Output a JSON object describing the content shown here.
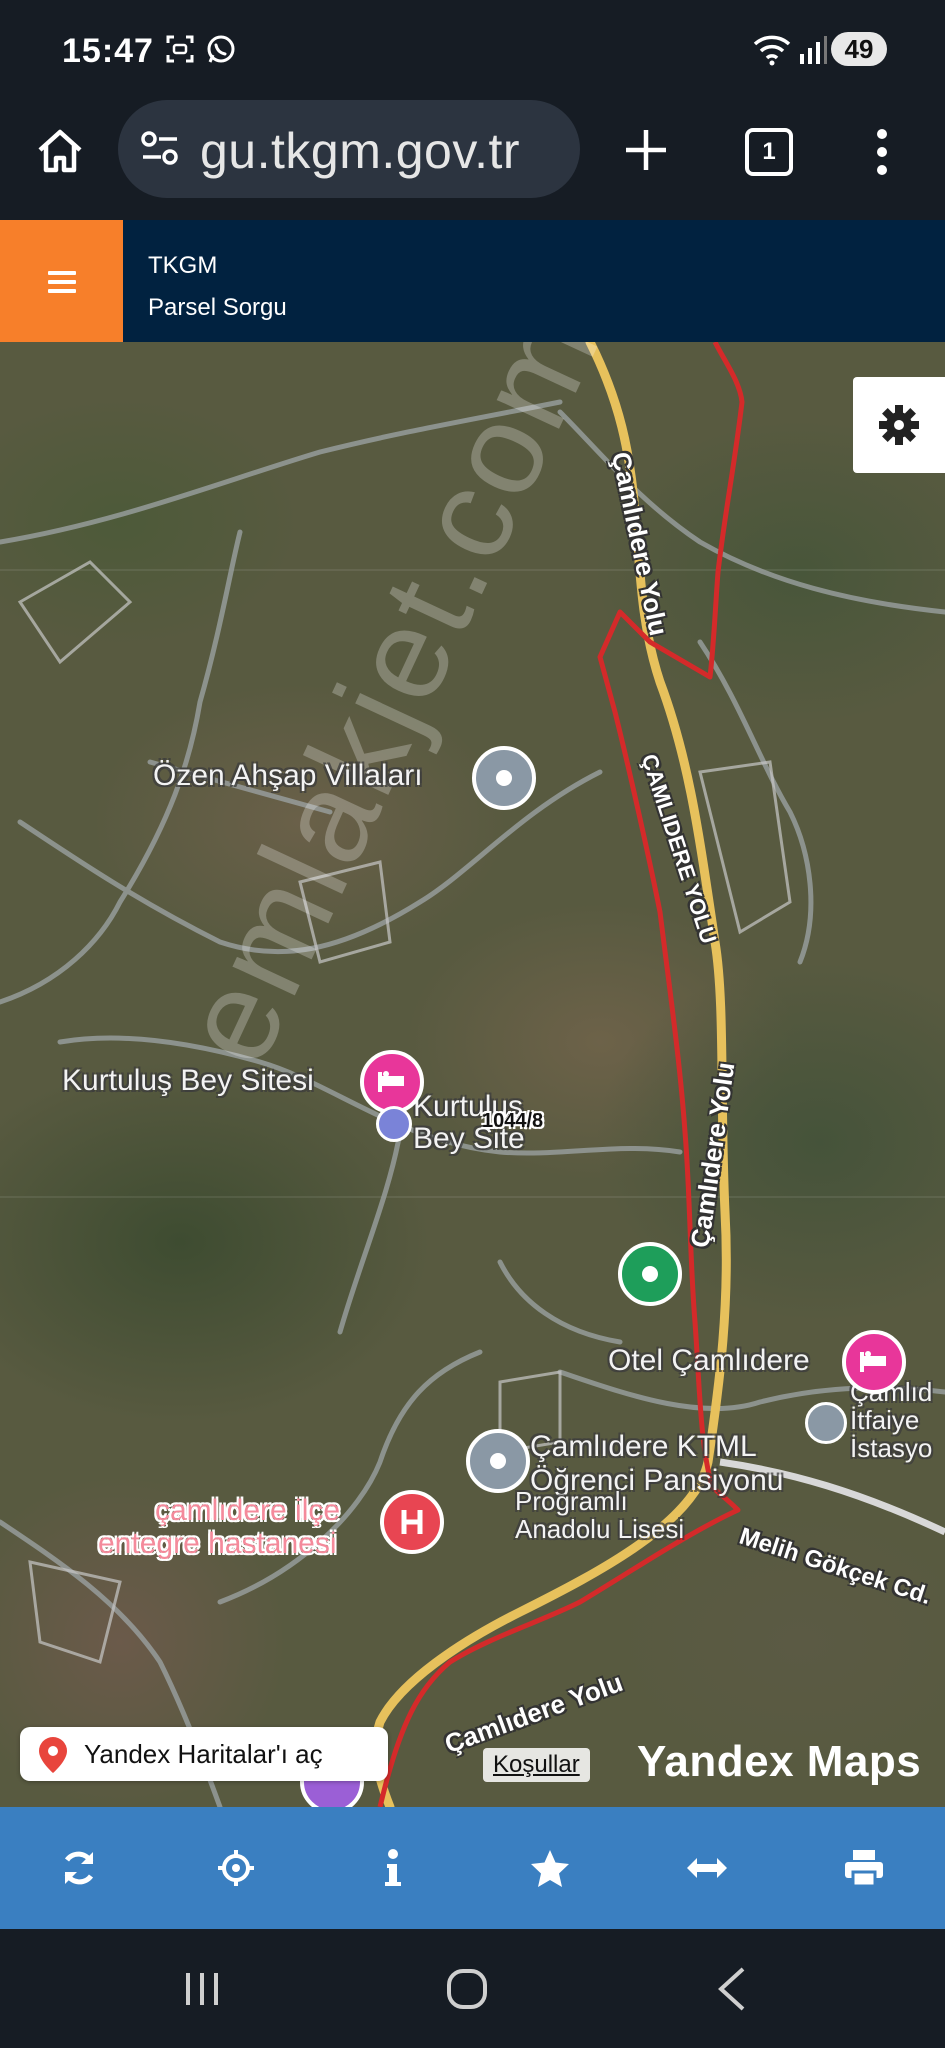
{
  "status": {
    "time": "15:47",
    "battery": "49"
  },
  "browser": {
    "url": "gu.tkgm.gov.tr",
    "tab_count": "1"
  },
  "app": {
    "title": "TKGM",
    "subtitle": "Parsel Sorgu"
  },
  "map": {
    "places": {
      "ozen": "Özen Ahşap Villaları",
      "kurtulus": "Kurtuluş Bey Sitesi",
      "kurtulus2a": "Kurtuluş",
      "kurtulus2b": "Bey Site",
      "otel": "Otel Çamlıdere",
      "itfaiye_a": "Çamlıd",
      "itfaiye_b": "İtfaiye",
      "itfaiye_c": "İstasyo",
      "ktml": "Çamlıdere KTML",
      "pansiyon": "Öğrenci Pansiyonu",
      "programli": "Programlı",
      "anadolu": "Anadolu Lisesi",
      "hastane_a": "çamlıdere ilçe",
      "hastane_b": "entegre hastanesi"
    },
    "roads": {
      "camlidere_yolu": "Çamlıdere Yolu",
      "camlidere_yolu_caps": "ÇAMLIDERE YOLU",
      "melih": "Melih Gökçek Cd."
    },
    "parcel_label": "1044/8",
    "watermark": "emlakjet.com",
    "yandex_link": "Yandex Haritalar'ı aç",
    "terms": "Koşullar",
    "brand": "Yandex Maps"
  },
  "colors": {
    "header": "#012240",
    "menu": "#f77f2a",
    "toolbar": "#3a7fc1",
    "parcel": "#d42a2a"
  },
  "toolbar_icons": [
    "refresh-icon",
    "locate-icon",
    "info-icon",
    "star-icon",
    "measure-icon",
    "print-icon"
  ]
}
